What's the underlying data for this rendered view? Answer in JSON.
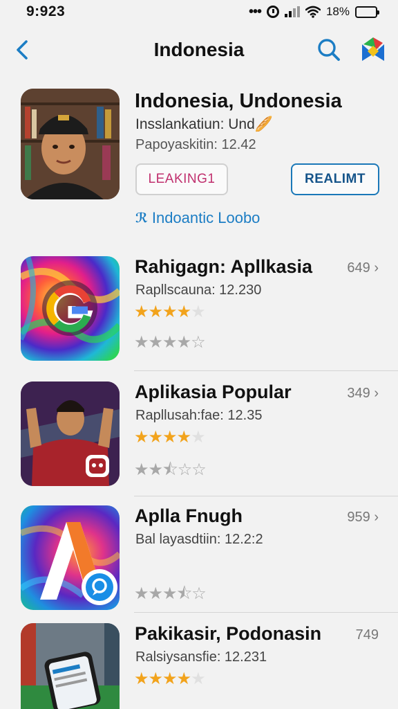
{
  "status_bar": {
    "time": "9:923",
    "dots": "•••",
    "battery": "18%"
  },
  "nav": {
    "title": "Indonesia",
    "back_icon": "chevron-left-icon",
    "search_icon": "search-icon",
    "store_icon": "app-store-logo-icon"
  },
  "featured": {
    "title": "Indonesia, Undonesia",
    "subtitle": "Insslankatiun: Und",
    "subtitle_emoji": "🥖",
    "meta": "Papoyaskitin: 12.42",
    "button_left": "LEAKING1",
    "button_right": "REALIMT",
    "link_glyph": "ℛ",
    "link_text": "Indoantic Loobo"
  },
  "apps": [
    {
      "title": "Rahigagn: Apllkasia",
      "subtitle": "Rapllscauna: 12.230",
      "count": "649 ›",
      "rating_a": 4,
      "rating_b": 4
    },
    {
      "title": "Aplikasia Popular",
      "subtitle": "Rapllusah:fae: 12.35",
      "count": "349 ›",
      "rating_a": 4,
      "rating_b": 2.5
    },
    {
      "title": "Aplla Fnugh",
      "subtitle": "Bal layasdtiin: 12.2:2",
      "count": "959 ›",
      "rating_b": 3.5
    },
    {
      "title": "Pakikasir, Podonasin",
      "subtitle": "Ralsiysansfie: 12.231",
      "count": "749",
      "rating_a": 4
    }
  ],
  "colors": {
    "accent_blue": "#1c7dc4",
    "star_gold": "#f2a31c",
    "button_pink": "#c0306e"
  }
}
